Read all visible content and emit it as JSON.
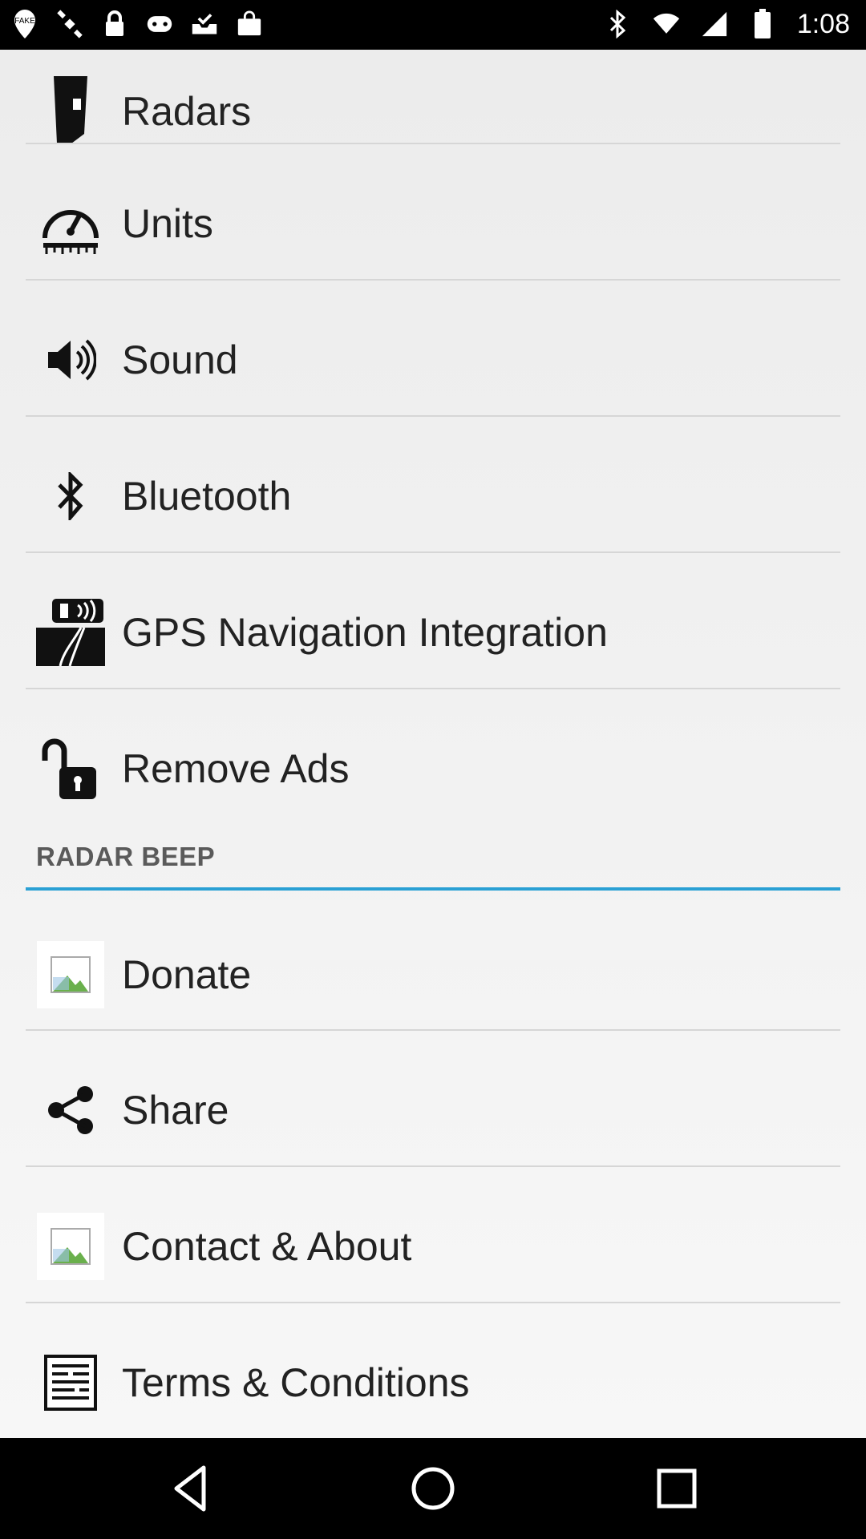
{
  "status_bar": {
    "time": "1:08",
    "left_icons": [
      "fake-gps-icon",
      "satellite-icon",
      "lock-icon",
      "gamepad-icon",
      "inbox-check-icon",
      "shopping-bag-icon"
    ],
    "right_icons": [
      "bluetooth-icon",
      "wifi-icon",
      "signal-icon",
      "battery-icon"
    ]
  },
  "menu": {
    "items": [
      {
        "label": "Radars",
        "icon": "radar-detector-icon"
      },
      {
        "label": "Units",
        "icon": "speedometer-icon"
      },
      {
        "label": "Sound",
        "icon": "speaker-icon"
      },
      {
        "label": "Bluetooth",
        "icon": "bluetooth-icon"
      },
      {
        "label": "GPS Navigation Integration",
        "icon": "road-navigation-icon"
      },
      {
        "label": "Remove Ads",
        "icon": "unlocked-padlock-icon"
      }
    ]
  },
  "section": {
    "title": "RADAR BEEP",
    "accent_color": "#2aa0d4",
    "items": [
      {
        "label": "Donate",
        "icon": "image-placeholder-icon"
      },
      {
        "label": "Share",
        "icon": "share-icon"
      },
      {
        "label": "Contact & About",
        "icon": "image-placeholder-icon"
      },
      {
        "label": "Terms & Conditions",
        "icon": "document-icon"
      }
    ]
  },
  "nav_bar": {
    "buttons": [
      "back-icon",
      "home-icon",
      "recents-icon"
    ]
  }
}
